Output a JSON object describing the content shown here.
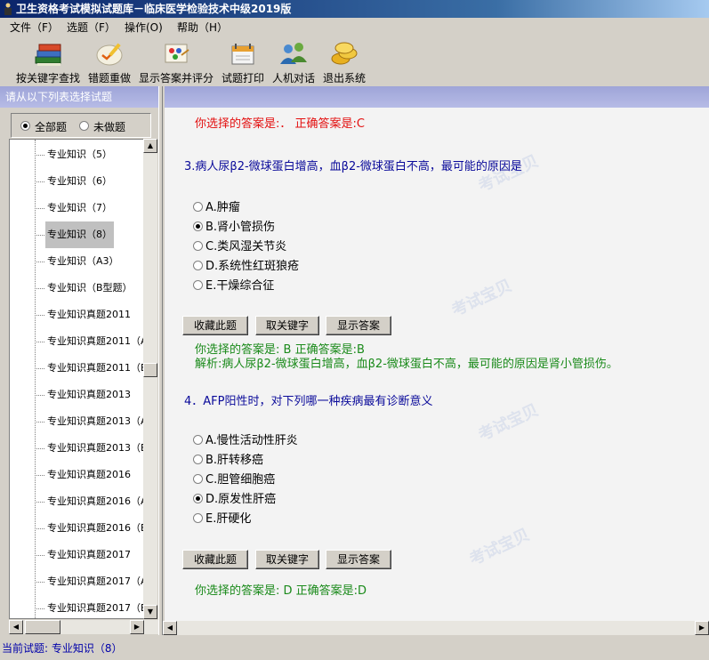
{
  "window": {
    "title": "卫生资格考试模拟试题库－临床医学检验技术中级2019版"
  },
  "menu": [
    "文件（F）",
    "选题（F）",
    "操作(O)",
    "帮助（H）"
  ],
  "toolbar": [
    {
      "label": "按关键字查找",
      "icon": "books-icon"
    },
    {
      "label": "错题重做",
      "icon": "pen-icon"
    },
    {
      "label": "显示答案并评分",
      "icon": "palette-icon"
    },
    {
      "label": "试题打印",
      "icon": "calendar-printer-icon"
    },
    {
      "label": "人机对话",
      "icon": "users-icon"
    },
    {
      "label": "退出系统",
      "icon": "coins-icon"
    }
  ],
  "left_header": "请从以下列表选择试题",
  "filters": {
    "all": "全部题",
    "undone": "未做题",
    "selected": "all"
  },
  "tree_items": [
    "专业知识（5）",
    "专业知识（6）",
    "专业知识（7）",
    "专业知识（8）",
    "专业知识（A3）",
    "专业知识（B型题）",
    "专业知识真题2011",
    "专业知识真题2011（A",
    "专业知识真题2011（B",
    "专业知识真题2013",
    "专业知识真题2013（A",
    "专业知识真题2013（B",
    "专业知识真题2016",
    "专业知识真题2016（A",
    "专业知识真题2016（B",
    "专业知识真题2017",
    "专业知识真题2017（A",
    "专业知识真题2017（B"
  ],
  "tree_selected_index": 3,
  "content": {
    "prev_answer": "你选择的答案是:．  正确答案是:C",
    "questions": [
      {
        "text": "3.病人尿β2-微球蛋白增高，血β2-微球蛋白不高，最可能的原因是",
        "options": [
          "A.肿瘤",
          "B.肾小管损伤",
          "C.类风湿关节炎",
          "D.系统性红斑狼疮",
          "E.干燥综合征"
        ],
        "selected": 1,
        "buttons": [
          "收藏此题",
          "取关键字",
          "显示答案"
        ],
        "result": "你选择的答案是: B   正确答案是:B",
        "analysis": "解析:病人尿β2-微球蛋白增高，血β2-微球蛋白不高，最可能的原因是肾小管损伤。"
      },
      {
        "text": "4．AFP阳性时，对下列哪一种疾病最有诊断意义",
        "options": [
          "A.慢性活动性肝炎",
          "B.肝转移癌",
          "C.胆管细胞癌",
          "D.原发性肝癌",
          "E.肝硬化"
        ],
        "selected": 3,
        "buttons": [
          "收藏此题",
          "取关键字",
          "显示答案"
        ],
        "result": "你选择的答案是: D   正确答案是:D"
      }
    ]
  },
  "status": "当前试题: 专业知识（8）",
  "colors": {
    "red": "#e31010",
    "blue": "#0a0a9a",
    "green": "#1a8a1a",
    "header": "#a9aee0"
  }
}
